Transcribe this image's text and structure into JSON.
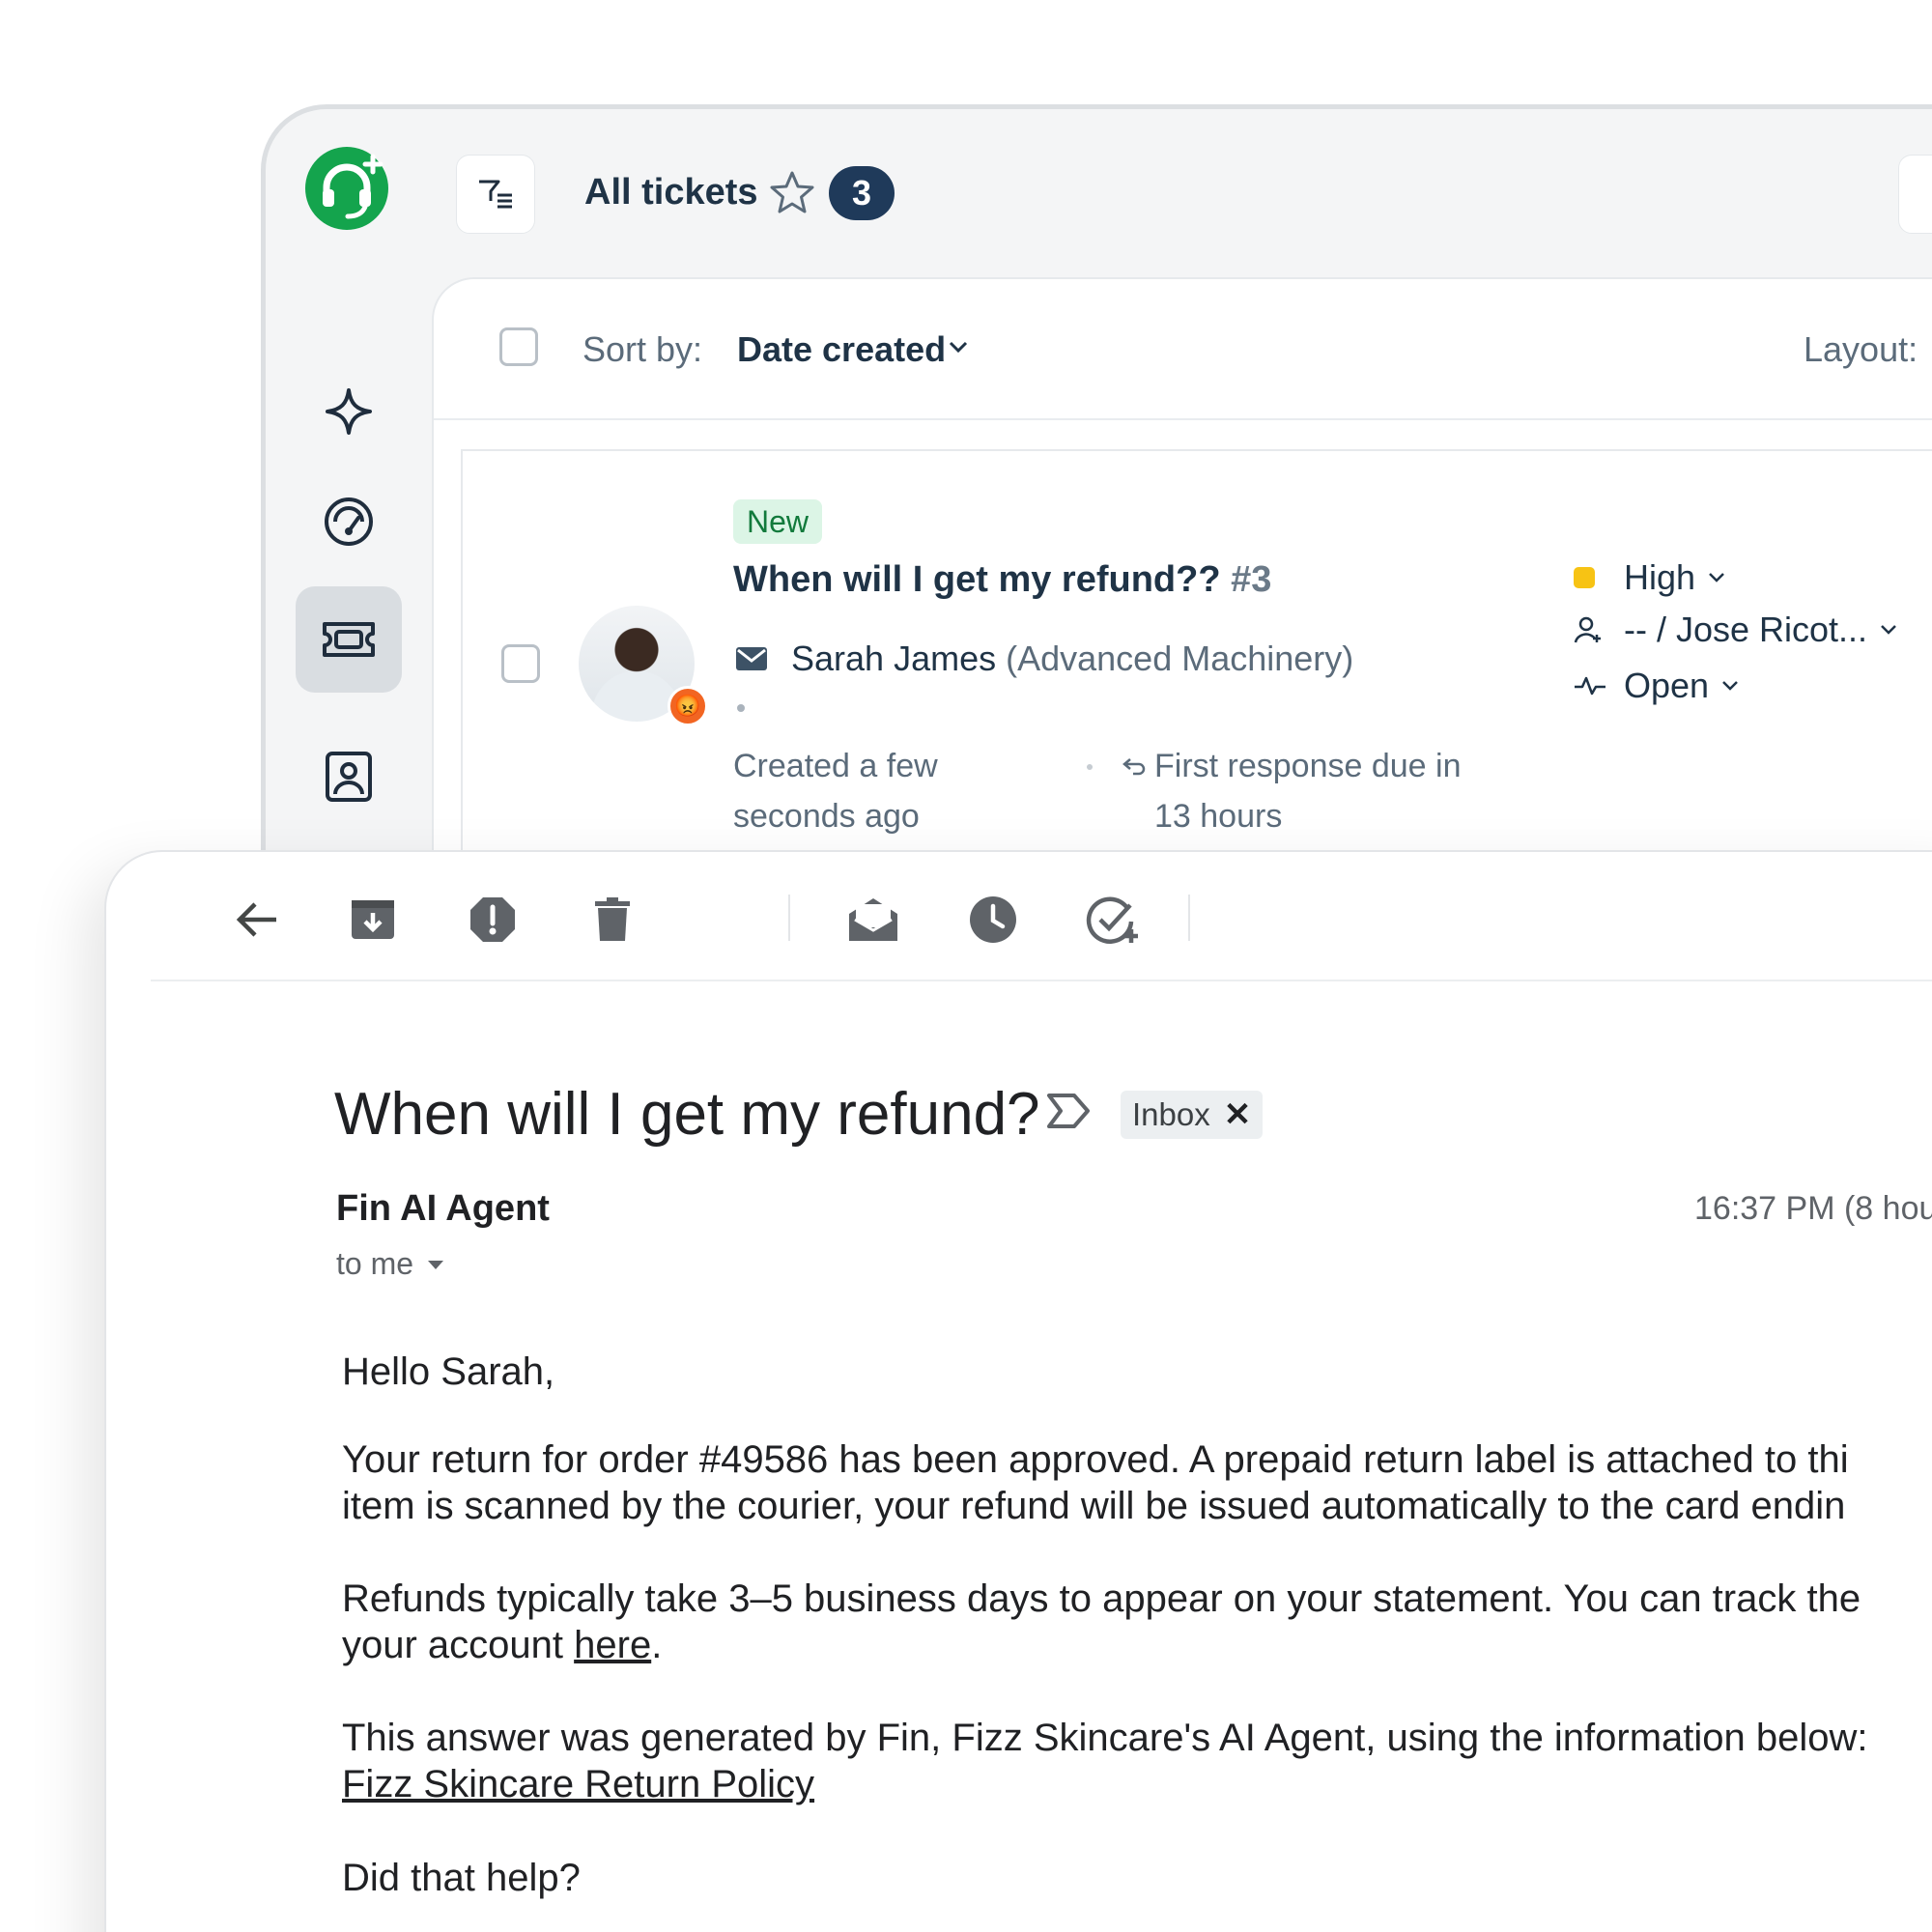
{
  "helpdesk": {
    "view_title": "All tickets",
    "ticket_count": "3",
    "sort_label": "Sort by:",
    "sort_value": "Date created",
    "layout_label": "Layout:",
    "ticket": {
      "status_badge": "New",
      "subject": "When will I get my refund??",
      "number": "#3",
      "requester_name": "Sarah James",
      "requester_company": "(Advanced Machinery)",
      "created_line1": "Created a few",
      "created_line2": "seconds ago",
      "due_line1": "First response due in",
      "due_line2": "13 hours",
      "priority": "High",
      "assignee": "-- / Jose Ricot...",
      "status": "Open"
    },
    "colors": {
      "brand_green": "#14a44d",
      "badge_navy": "#1f3a5a",
      "priority_yellow": "#f7c314",
      "new_badge_bg": "#dcf5e6"
    }
  },
  "email": {
    "subject": "When will I get my refund?",
    "label_chip": "Inbox",
    "label_remove": "✕",
    "sender": "Fin AI Agent",
    "time": "16:37 PM (8 hou",
    "recipient": "to me",
    "body": {
      "greeting": "Hello Sarah,",
      "p1_line1": "Your return for order #49586 has been approved. A prepaid return label is attached to thi",
      "p1_line2": "item is scanned by the courier, your refund will be issued automatically to the card endin",
      "p2_line1": "Refunds typically take 3–5 business days to appear on your statement. You can track the",
      "p2_line2_prefix": "your account ",
      "p2_link": "here",
      "p2_suffix": ".",
      "p3_line1": "This answer was generated by Fin, Fizz Skincare's AI Agent, using the information below:",
      "p3_link": "Fizz Skincare Return Policy",
      "closing": "Did that help?"
    }
  }
}
